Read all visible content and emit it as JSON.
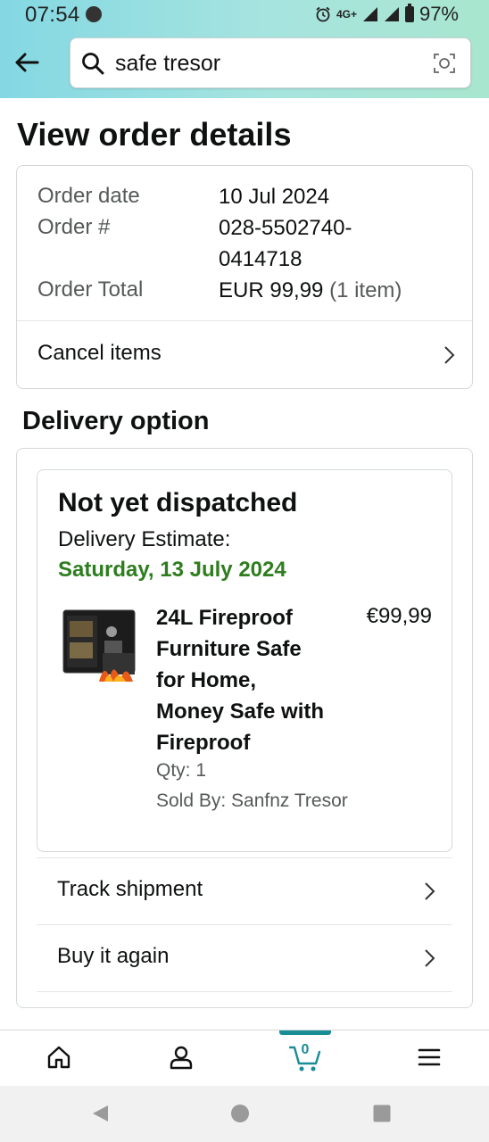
{
  "status_bar": {
    "time": "07:54",
    "network": "4G+",
    "battery": "97%"
  },
  "search": {
    "query": "safe tresor"
  },
  "page": {
    "title": "View order details"
  },
  "order": {
    "date_label": "Order date",
    "date_value": "10 Jul 2024",
    "number_label": "Order #",
    "number_line1": "028-5502740-",
    "number_line2": "0414718",
    "total_label": "Order Total",
    "total_value": "EUR 99,99",
    "total_items": "(1 item)",
    "cancel_label": "Cancel items"
  },
  "delivery": {
    "section_title": "Delivery option",
    "status": "Not yet dispatched",
    "estimate_label": "Delivery Estimate:",
    "estimate_date": "Saturday, 13 July 2024",
    "estimate_color": "#2e7d1e",
    "product": {
      "title_lines": [
        "24L Fireproof",
        "Furniture Safe",
        "for Home,",
        "Money Safe with",
        "Fireproof"
      ],
      "price": "€99,99",
      "qty": "Qty: 1",
      "sold_by": "Sold By: Sanfnz Tresor"
    },
    "track_label": "Track shipment",
    "buy_again_label": "Buy it again"
  },
  "bottom_nav": {
    "items": [
      {
        "icon": "home-icon"
      },
      {
        "icon": "account-icon"
      },
      {
        "icon": "cart-icon",
        "count": "0",
        "active": true
      },
      {
        "icon": "menu-icon"
      }
    ],
    "accent": "#1a8c95"
  }
}
